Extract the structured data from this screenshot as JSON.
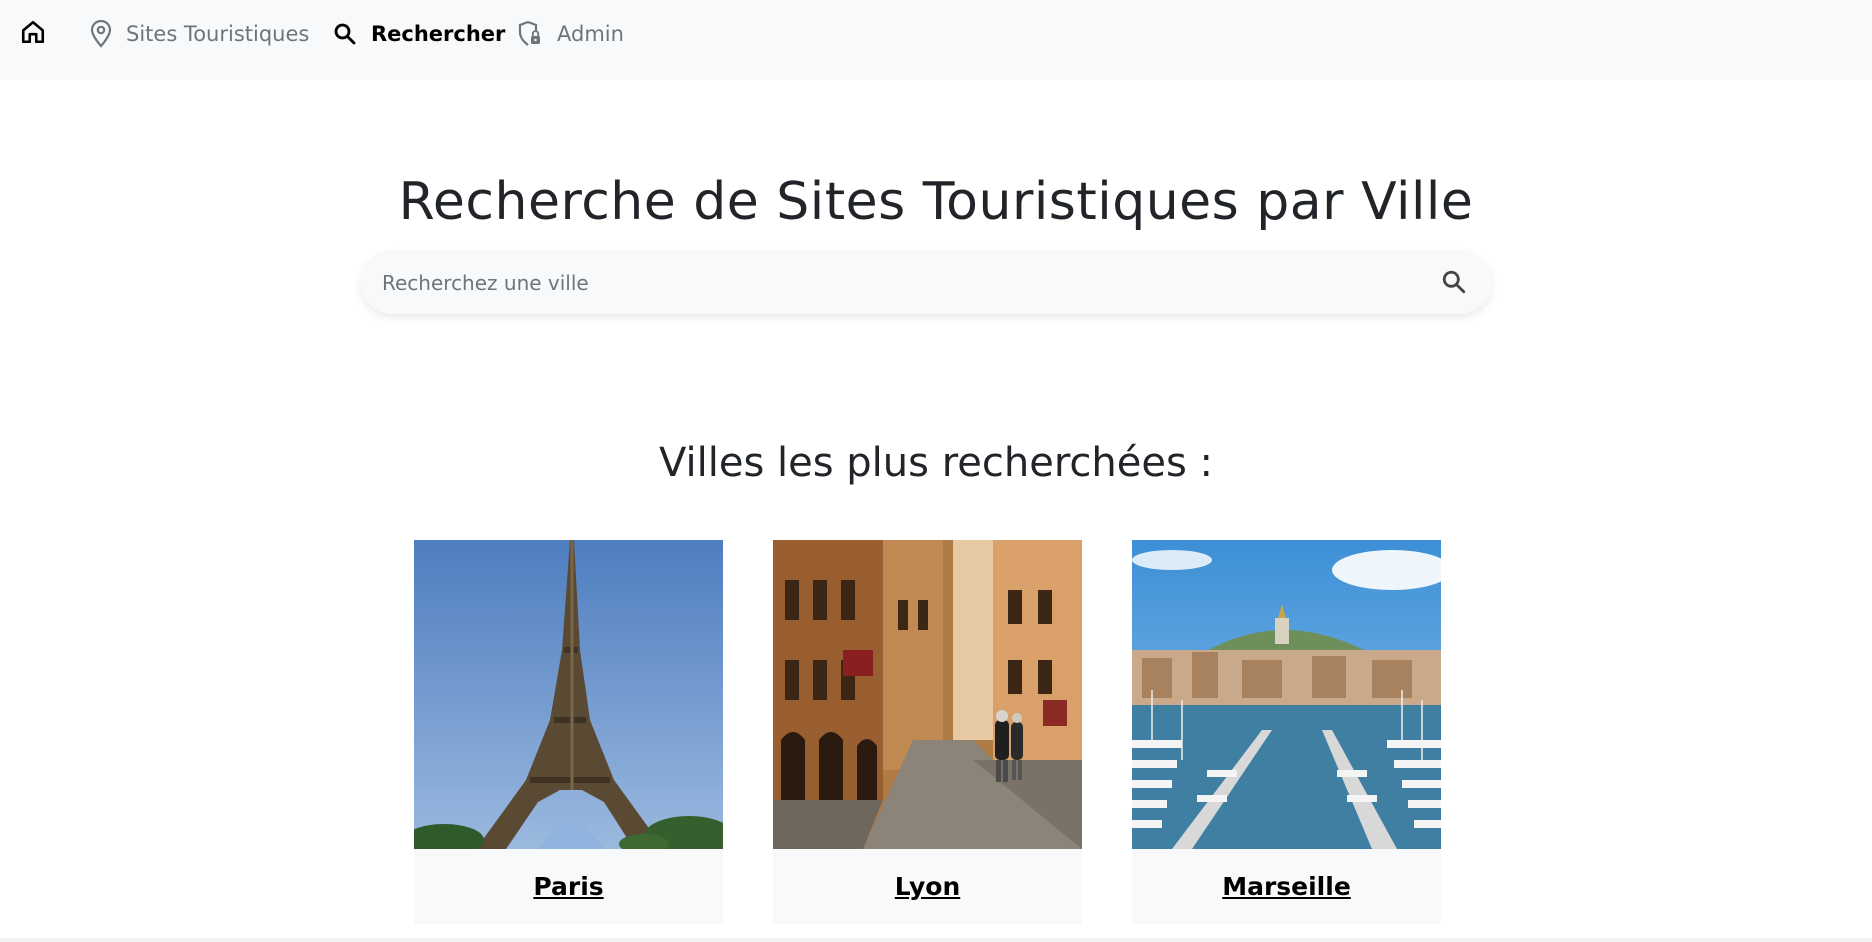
{
  "navbar": {
    "home_icon": "home-icon",
    "items": [
      {
        "label": "Sites Touristiques",
        "icon": "map-pin-icon",
        "active": false
      },
      {
        "label": "Rechercher",
        "icon": "search-icon",
        "active": true
      },
      {
        "label": "Admin",
        "icon": "shield-lock-icon",
        "active": false
      }
    ]
  },
  "search": {
    "title": "Recherche de Sites Touristiques par Ville",
    "placeholder": "Recherchez une ville",
    "button_icon": "search-icon"
  },
  "popular": {
    "title": "Villes les plus recherchées :",
    "cities": [
      {
        "name": "Paris",
        "image": "eiffel-tower-photo"
      },
      {
        "name": "Lyon",
        "image": "old-town-street-photo"
      },
      {
        "name": "Marseille",
        "image": "old-port-marina-photo"
      }
    ]
  },
  "colors": {
    "navbar_bg": "#f8f9fa",
    "text": "#212529",
    "muted": "#6c757d",
    "card_bg": "#f8f9fa"
  }
}
